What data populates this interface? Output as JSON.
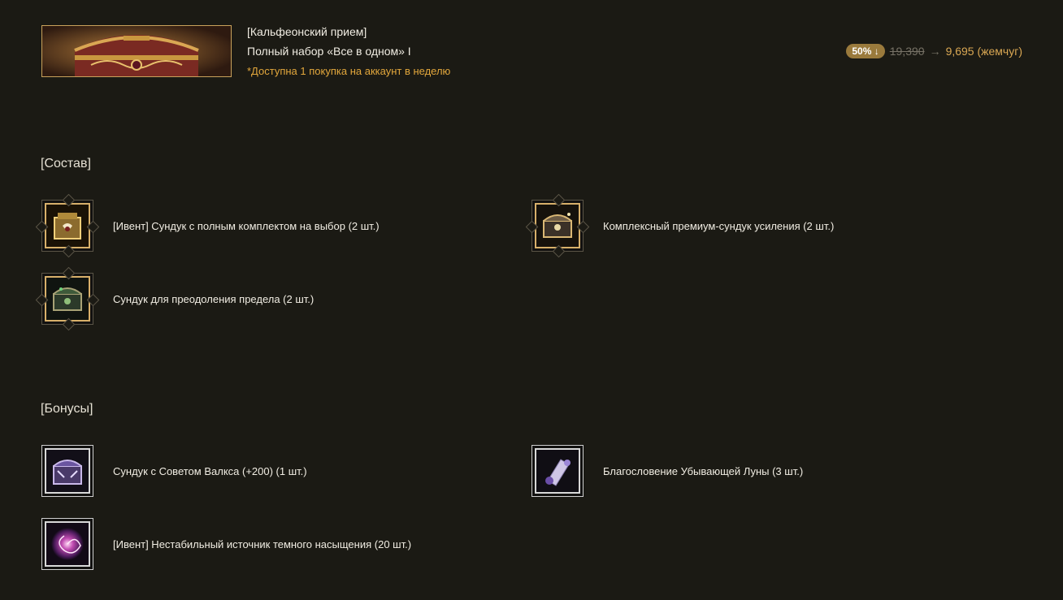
{
  "header": {
    "category": "[Кальфеонский прием]",
    "name": "Полный набор «Все в одном» I",
    "limit_note": "*Доступна 1 покупка на аккаунт в неделю"
  },
  "price": {
    "discount": "50% ↓",
    "old": "19,390",
    "arrow": "→",
    "new": "9,695 (жемчуг)"
  },
  "contents": {
    "title": "[Состав]",
    "items": [
      {
        "label": "[Ивент] Сундук с полным комплектом на выбор (2 шт.)",
        "icon": "gold-chest-icon"
      },
      {
        "label": "Комплексный премиум-сундук усиления (2 шт.)",
        "icon": "premium-chest-icon"
      },
      {
        "label": "Сундук для преодоления предела (2 шт.)",
        "icon": "green-chest-icon"
      }
    ]
  },
  "bonuses": {
    "title": "[Бонусы]",
    "items": [
      {
        "label": "Сундук с Советом Валкса (+200) (1 шт.)",
        "icon": "purple-chest-icon"
      },
      {
        "label": "Благословение Убывающей Луны (3 шт.)",
        "icon": "scroll-icon"
      },
      {
        "label": "[Ивент] Нестабильный источник темного насыщения (20 шт.)",
        "icon": "galaxy-orb-icon"
      }
    ]
  },
  "colors": {
    "background": "#1b1a14",
    "accent_gold": "#d9a753",
    "note_orange": "#e2a73c"
  }
}
